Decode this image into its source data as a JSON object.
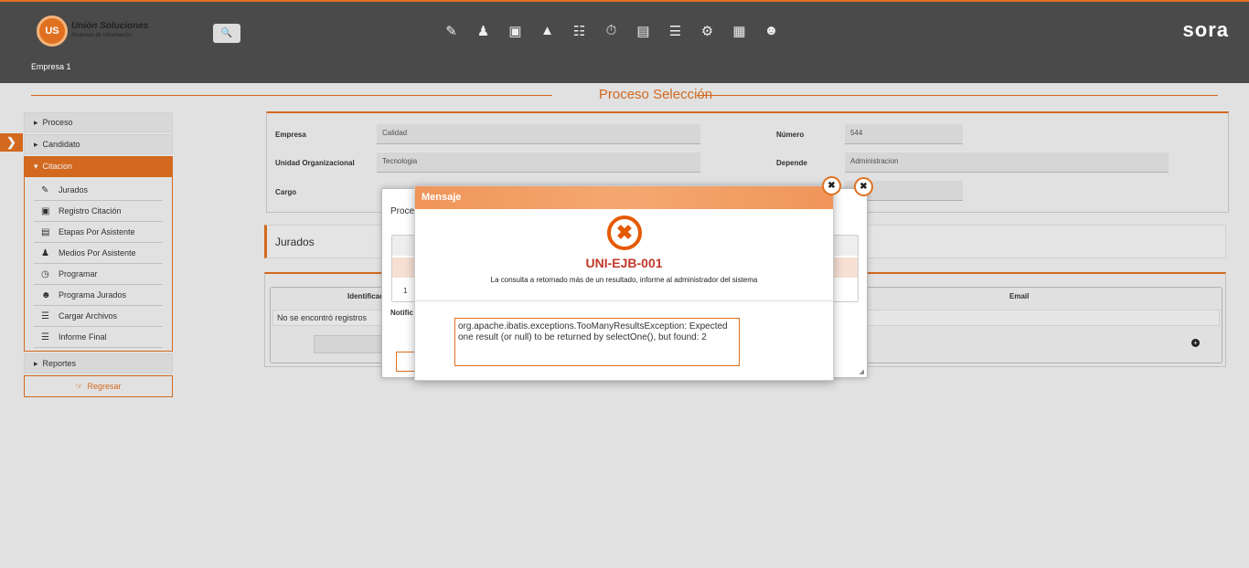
{
  "header": {
    "logo_initials": "US",
    "logo_name": "Unión Soluciones",
    "logo_tagline": "Sistemas de Información",
    "brand": "sora",
    "company": "Empresa 1",
    "toolbar_icons": [
      "document-edit-icon",
      "person-icon",
      "gift-icon",
      "org-chart-icon",
      "people-list-icon",
      "stopwatch-icon",
      "report-icon",
      "presentation-icon",
      "gears-icon",
      "briefcase-icon",
      "group-icon"
    ]
  },
  "page": {
    "title": "Proceso Selección"
  },
  "sidebar": {
    "items": [
      {
        "label": "Proceso"
      },
      {
        "label": "Candidato"
      },
      {
        "label": "Citacion"
      }
    ],
    "sub_items": [
      {
        "label": "Jurados",
        "icon": "jurado-icon"
      },
      {
        "label": "Registro Citación",
        "icon": "register-icon"
      },
      {
        "label": "Etapas Por Asistente",
        "icon": "stages-icon"
      },
      {
        "label": "Medios Por Asistente",
        "icon": "user-icon"
      },
      {
        "label": "Programar",
        "icon": "clock-icon"
      },
      {
        "label": "Programa Jurados",
        "icon": "people-icon"
      },
      {
        "label": "Cargar Archivos",
        "icon": "list-icon"
      },
      {
        "label": "Informe Final",
        "icon": "list-icon"
      }
    ],
    "reportes": "Reportes",
    "regresar": "Regresar"
  },
  "form": {
    "empresa_label": "Empresa",
    "empresa_value": "Calidad",
    "numero_label": "Número",
    "numero_value": "544",
    "unidad_label": "Unidad Organizacional",
    "unidad_value": "Tecnologia",
    "depende_label": "Depende",
    "depende_value": "Administracion",
    "cargo_label": "Cargo"
  },
  "jurados": {
    "title": "Jurados",
    "col_identificacion": "Identificac",
    "col_email": "Email",
    "empty_text": "No se encontró registros"
  },
  "back_dialog": {
    "title": "Proce",
    "page": "1",
    "notif": "Notific"
  },
  "message_dialog": {
    "title": "Mensaje",
    "code": "UNI-EJB-001",
    "message": "La consulta a retornado más de un resultado, informe al administrador del sistema",
    "detail": "org.apache.ibatis.exceptions.TooManyResultsException: Expected one result (or null) to be returned by selectOne(), but found: 2"
  },
  "colors": {
    "accent": "#e07020",
    "header_bg": "#4a4a4a",
    "error_red": "#c0392b"
  }
}
